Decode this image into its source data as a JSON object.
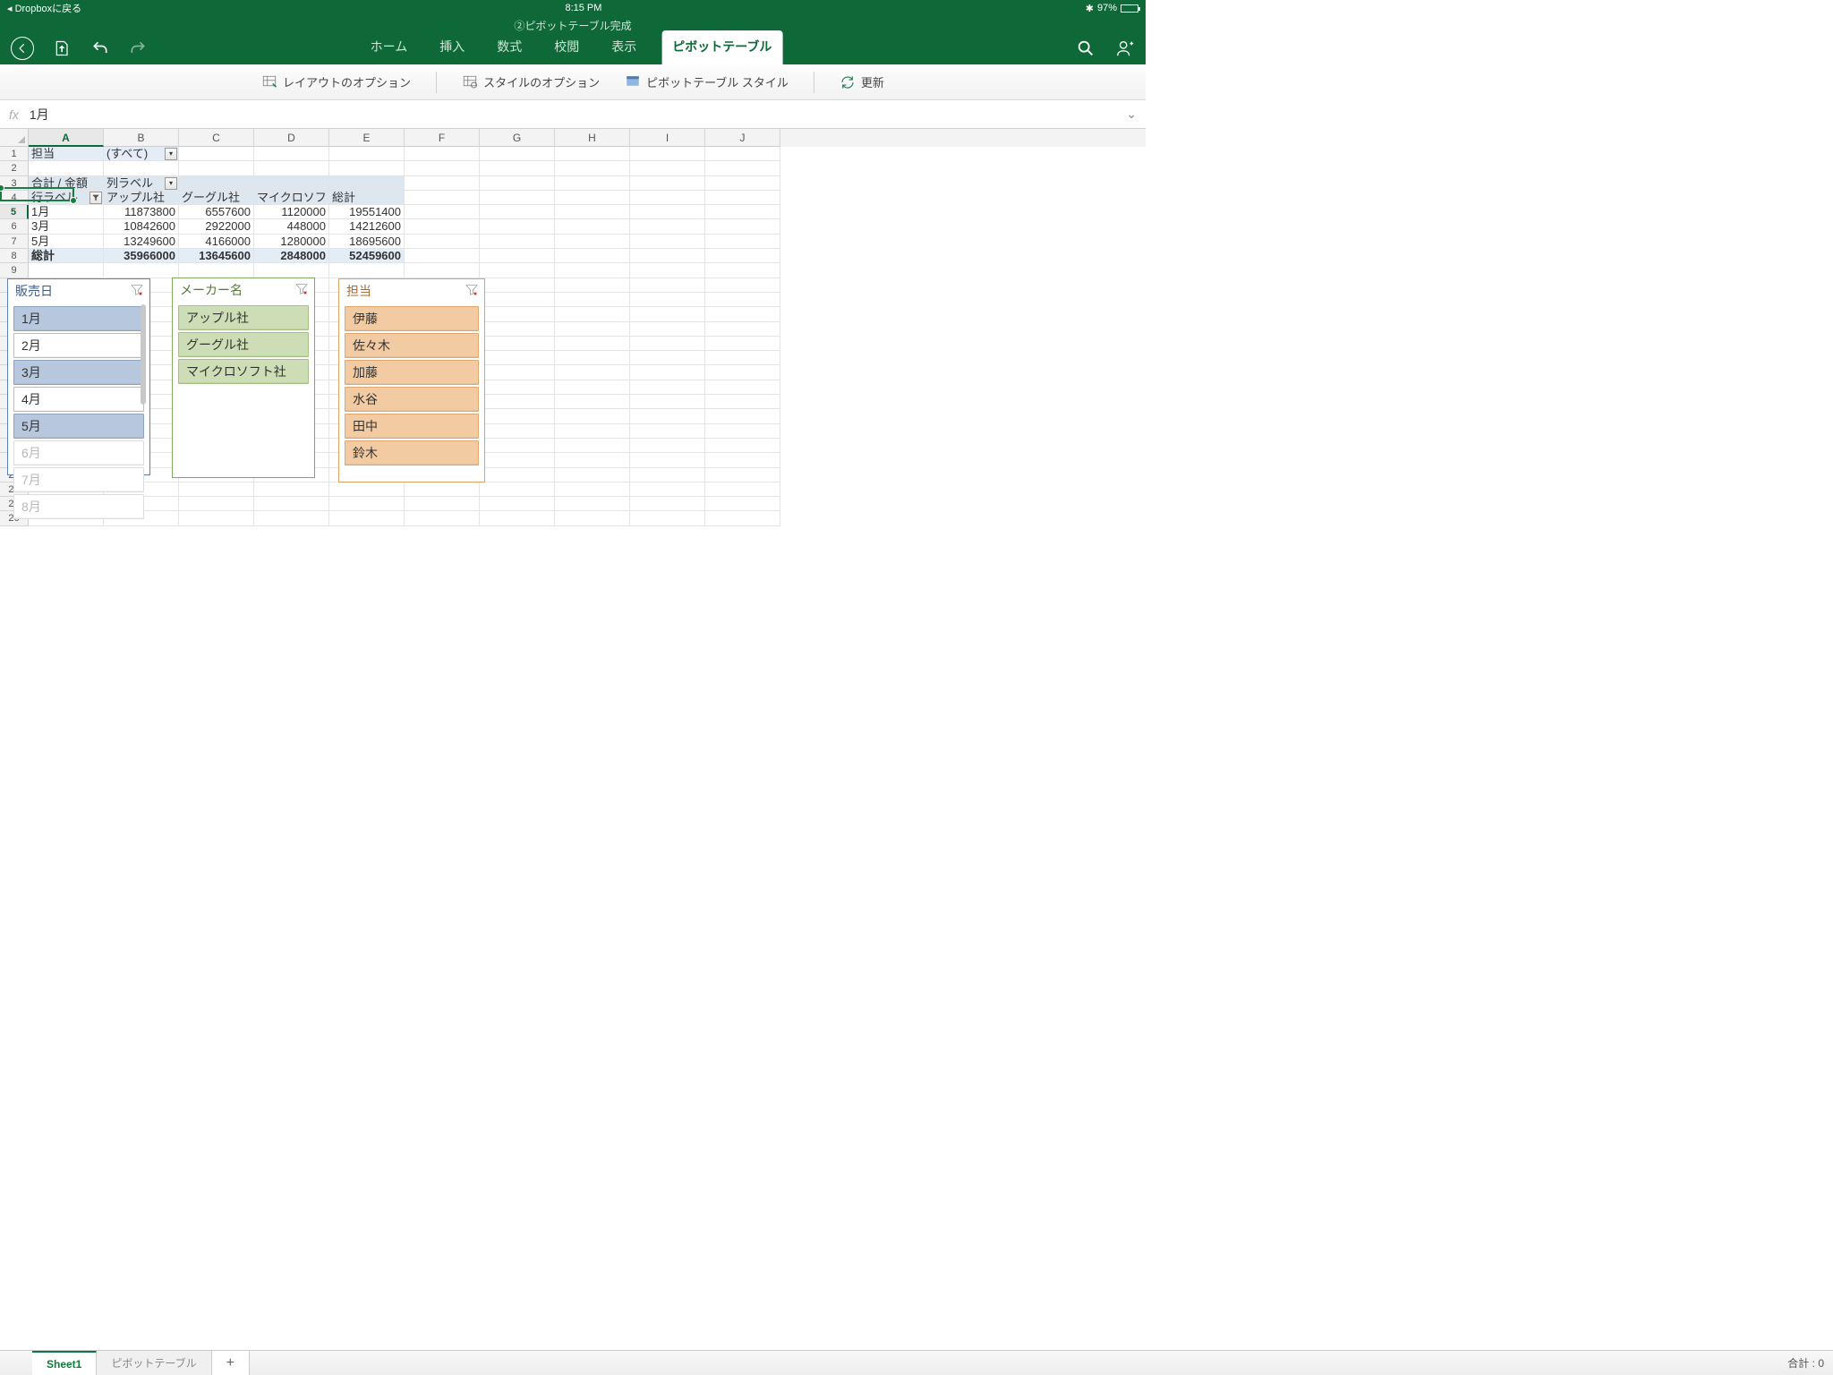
{
  "status": {
    "back_app": "Dropboxに戻る",
    "time": "8:15 PM",
    "battery_pct": "97%"
  },
  "title": "②ピボットテーブル完成",
  "toolbar_tabs": {
    "home": "ホーム",
    "insert": "挿入",
    "formulas": "数式",
    "review": "校閲",
    "view": "表示",
    "pivot": "ピボットテーブル"
  },
  "ribbon": {
    "layout_opt": "レイアウトのオプション",
    "style_opt": "スタイルのオプション",
    "pivot_styles": "ピボットテーブル スタイル",
    "refresh": "更新"
  },
  "formula": {
    "fx": "fx",
    "value": "1月"
  },
  "columns": [
    "A",
    "B",
    "C",
    "D",
    "E",
    "F",
    "G",
    "H",
    "I",
    "J"
  ],
  "rows": [
    "1",
    "2",
    "3",
    "4",
    "5",
    "6",
    "7",
    "8",
    "9",
    "10",
    "11",
    "12",
    "13",
    "14",
    "15",
    "16",
    "17",
    "18",
    "19",
    "20",
    "21",
    "22",
    "23",
    "24",
    "25",
    "26"
  ],
  "pivot": {
    "filter_label": "担当",
    "filter_value": "(すべて)",
    "measure": "合計 / 金額",
    "col_label": "列ラベル",
    "row_label": "行ラベル",
    "cols": [
      "アップル社",
      "グーグル社",
      "マイクロソフト社",
      "総計"
    ],
    "rows_lbl": [
      "1月",
      "3月",
      "5月",
      "総計"
    ],
    "data": [
      [
        "11873800",
        "6557600",
        "1120000",
        "19551400"
      ],
      [
        "10842600",
        "2922000",
        "448000",
        "14212600"
      ],
      [
        "13249600",
        "4166000",
        "1280000",
        "18695600"
      ],
      [
        "35966000",
        "13645600",
        "2848000",
        "52459600"
      ]
    ]
  },
  "slicers": {
    "date": {
      "title": "販売日",
      "items": [
        {
          "l": "1月",
          "s": true
        },
        {
          "l": "2月",
          "s": false
        },
        {
          "l": "3月",
          "s": true
        },
        {
          "l": "4月",
          "s": false
        },
        {
          "l": "5月",
          "s": true
        },
        {
          "l": "6月",
          "s": false,
          "d": true
        },
        {
          "l": "7月",
          "s": false,
          "d": true
        },
        {
          "l": "8月",
          "s": false,
          "d": true
        }
      ]
    },
    "maker": {
      "title": "メーカー名",
      "items": [
        {
          "l": "アップル社",
          "s": true
        },
        {
          "l": "グーグル社",
          "s": true
        },
        {
          "l": "マイクロソフト社",
          "s": true
        }
      ]
    },
    "staff": {
      "title": "担当",
      "items": [
        {
          "l": "伊藤",
          "s": true
        },
        {
          "l": "佐々木",
          "s": true
        },
        {
          "l": "加藤",
          "s": true
        },
        {
          "l": "水谷",
          "s": true
        },
        {
          "l": "田中",
          "s": true
        },
        {
          "l": "鈴木",
          "s": true
        }
      ]
    }
  },
  "sheet_tabs": {
    "active": "Sheet1",
    "other": "ピボットテーブル"
  },
  "footer_sum_label": "合計",
  "footer_sum_value": ": 0"
}
